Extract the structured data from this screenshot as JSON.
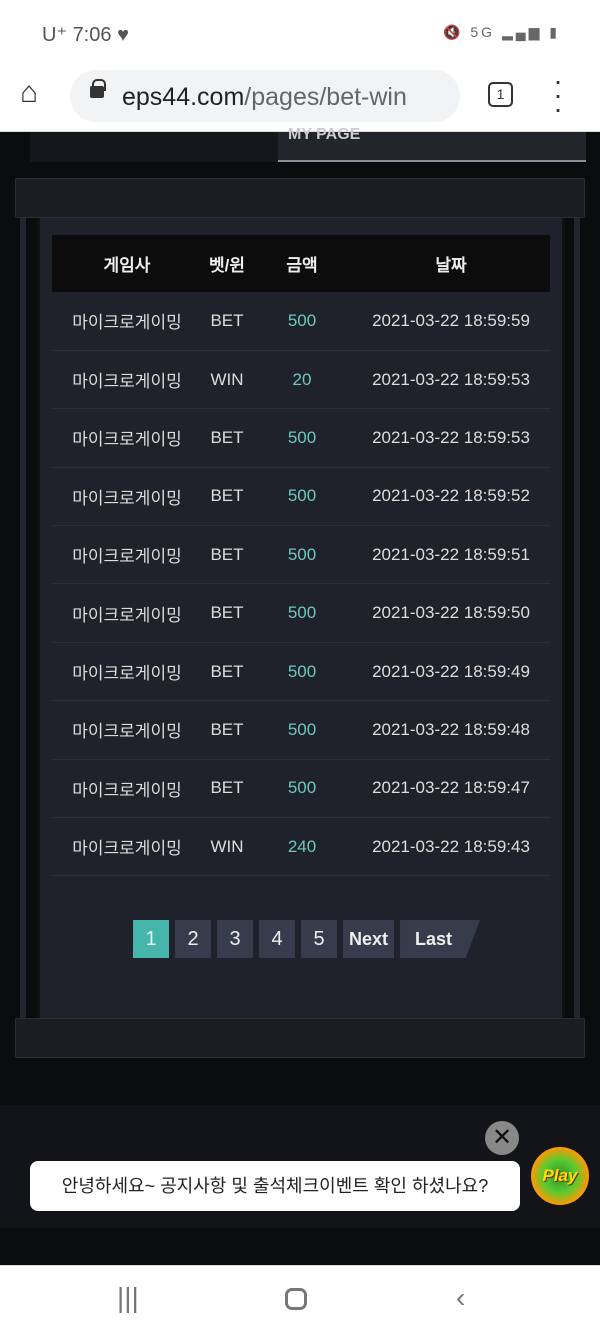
{
  "status_bar": {
    "carrier": "U⁺",
    "time": "7:06",
    "icons": [
      "heart-icon",
      "mute-icon",
      "5g-icon",
      "signal-icon",
      "battery-charging-icon"
    ]
  },
  "browser": {
    "url_domain": "eps44.com",
    "url_path": "/pages/bet-win",
    "tab_count": "1"
  },
  "header": {
    "my_page": "MY PAGE"
  },
  "table": {
    "headers": [
      "게임사",
      "벳/윈",
      "금액",
      "날짜"
    ],
    "rows": [
      [
        "마이크로게이밍",
        "BET",
        "500",
        "2021-03-22 18:59:59"
      ],
      [
        "마이크로게이밍",
        "WIN",
        "20",
        "2021-03-22 18:59:53"
      ],
      [
        "마이크로게이밍",
        "BET",
        "500",
        "2021-03-22 18:59:53"
      ],
      [
        "마이크로게이밍",
        "BET",
        "500",
        "2021-03-22 18:59:52"
      ],
      [
        "마이크로게이밍",
        "BET",
        "500",
        "2021-03-22 18:59:51"
      ],
      [
        "마이크로게이밍",
        "BET",
        "500",
        "2021-03-22 18:59:50"
      ],
      [
        "마이크로게이밍",
        "BET",
        "500",
        "2021-03-22 18:59:49"
      ],
      [
        "마이크로게이밍",
        "BET",
        "500",
        "2021-03-22 18:59:48"
      ],
      [
        "마이크로게이밍",
        "BET",
        "500",
        "2021-03-22 18:59:47"
      ],
      [
        "마이크로게이밍",
        "WIN",
        "240",
        "2021-03-22 18:59:43"
      ]
    ]
  },
  "pagination": {
    "pages": [
      "1",
      "2",
      "3",
      "4",
      "5"
    ],
    "active": "1",
    "next": "Next",
    "last": "Last"
  },
  "chat": {
    "message": "안녕하세요~ 공지사항 및 출석체크이벤트 확인 하셨나요?",
    "close": "✕",
    "logo_text": "Mr.Play"
  },
  "colors": {
    "accent": "#46b5ac",
    "amount": "#6cc9bd",
    "panel": "#1f222a"
  }
}
